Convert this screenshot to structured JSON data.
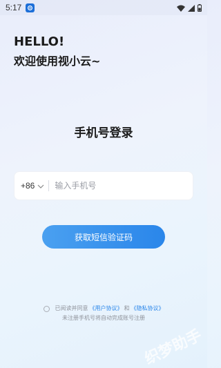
{
  "status_bar": {
    "time": "5:17",
    "icons": [
      "app-notification-icon",
      "wifi-icon",
      "signal-icon",
      "battery-icon"
    ]
  },
  "greeting": {
    "line1": "HELLO!",
    "line2": "欢迎使用视小云~"
  },
  "login": {
    "title": "手机号登录",
    "country_code": "+86",
    "phone_placeholder": "输入手机号",
    "phone_value": "",
    "get_code_label": "获取短信验证码"
  },
  "agreement": {
    "prefix": "已阅读并同意",
    "user_agreement": "《用户协议》",
    "and": "和",
    "privacy_agreement": "《隐私协议》",
    "note": "未注册手机号将自动完成账号注册",
    "checked": false
  },
  "watermark": "织梦助手",
  "colors": {
    "accent": "#2a86ea",
    "button_start": "#4aa0f0",
    "text_dark": "#1b1b1b",
    "muted": "#8f939b"
  }
}
